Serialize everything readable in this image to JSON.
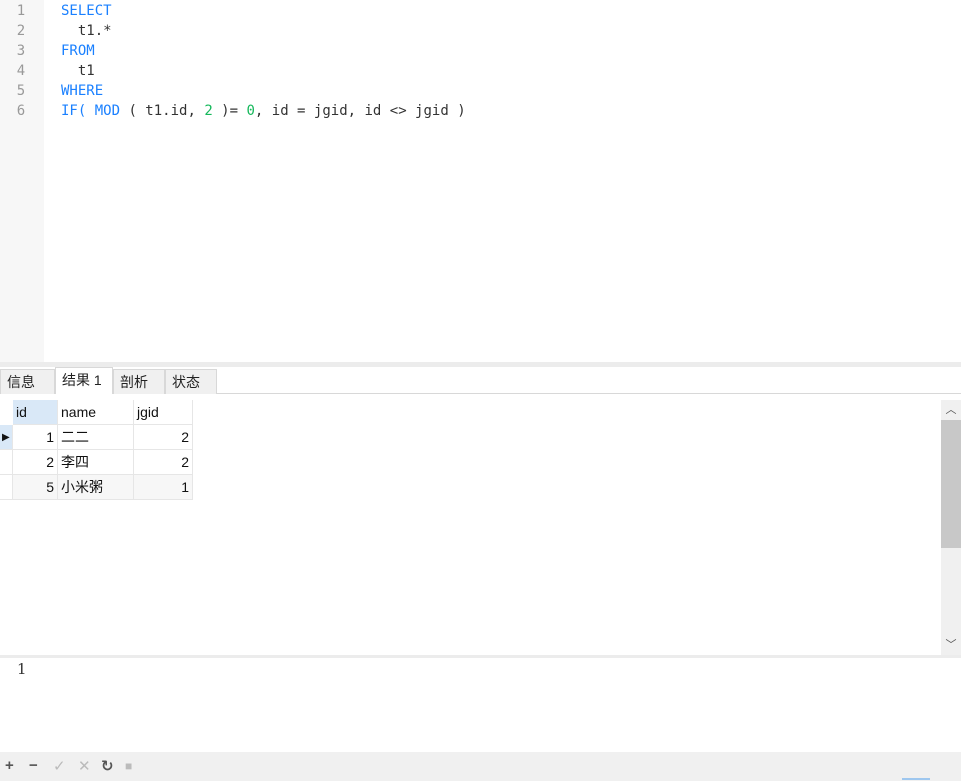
{
  "editor": {
    "lines": [
      {
        "n": "1",
        "parts": [
          {
            "t": "SELECT",
            "c": "kw"
          }
        ]
      },
      {
        "n": "2",
        "parts": [
          {
            "t": "  t1.*",
            "c": ""
          }
        ]
      },
      {
        "n": "3",
        "parts": [
          {
            "t": "FROM",
            "c": "kw"
          }
        ]
      },
      {
        "n": "4",
        "parts": [
          {
            "t": "  t1",
            "c": ""
          }
        ]
      },
      {
        "n": "5",
        "parts": [
          {
            "t": "WHERE",
            "c": "kw"
          }
        ]
      },
      {
        "n": "6",
        "parts": [
          {
            "t": "IF( ",
            "c": "kw"
          },
          {
            "t": "MOD",
            "c": "kw"
          },
          {
            "t": " ( t1.id, ",
            "c": ""
          },
          {
            "t": "2",
            "c": "num"
          },
          {
            "t": " )= ",
            "c": ""
          },
          {
            "t": "0",
            "c": "num"
          },
          {
            "t": ", id = jgid, id <> jgid )",
            "c": ""
          }
        ]
      }
    ]
  },
  "tabs": [
    {
      "label": "信息"
    },
    {
      "label": "结果 1"
    },
    {
      "label": "剖析"
    },
    {
      "label": "状态"
    }
  ],
  "grid": {
    "columns": [
      "id",
      "name",
      "jgid"
    ],
    "rows": [
      [
        "1",
        "二二",
        "2"
      ],
      [
        "2",
        "李四",
        "2"
      ],
      [
        "5",
        "小米粥",
        "1"
      ]
    ]
  },
  "message": "1",
  "toolbar": {
    "add": "+",
    "remove": "−",
    "apply": "✓",
    "discard": "✕",
    "refresh": "↻",
    "stop": "■"
  }
}
